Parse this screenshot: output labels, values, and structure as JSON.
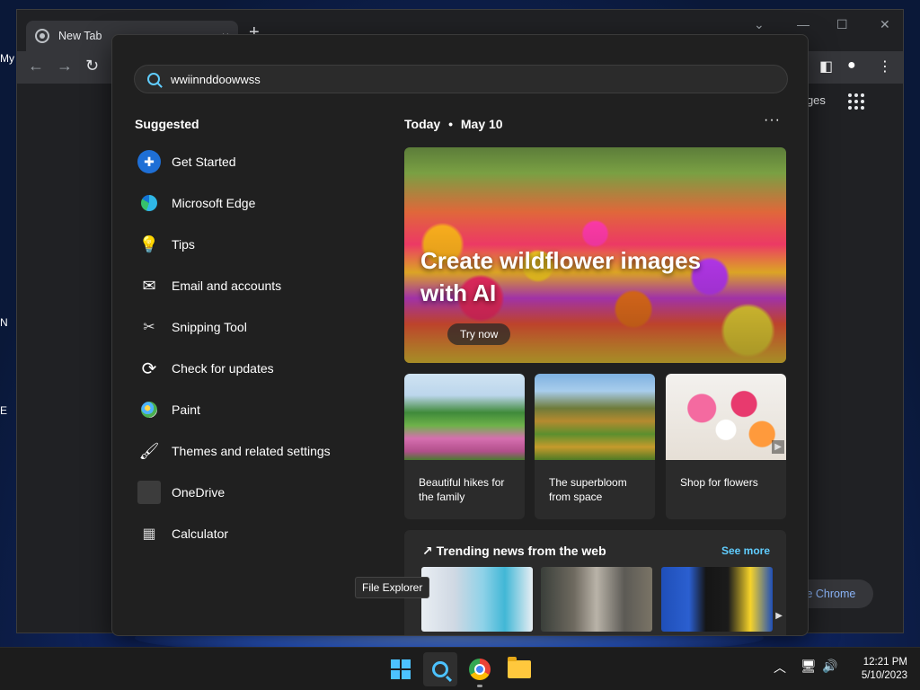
{
  "desktop": {
    "icon_labels": [
      "My",
      "N",
      "E"
    ]
  },
  "chrome": {
    "tab_title": "New Tab",
    "tab_close": "×",
    "new_tab": "+",
    "images_link": "images",
    "customize_label": "mize Chrome"
  },
  "search": {
    "query": "wwiinnddoowwss"
  },
  "suggested": {
    "heading": "Suggested",
    "items": [
      {
        "label": "Get Started",
        "icon": "get-started-icon"
      },
      {
        "label": "Microsoft Edge",
        "icon": "edge-icon"
      },
      {
        "label": "Tips",
        "icon": "tips-icon"
      },
      {
        "label": "Email and accounts",
        "icon": "mail-icon"
      },
      {
        "label": "Snipping Tool",
        "icon": "snipping-tool-icon"
      },
      {
        "label": "Check for updates",
        "icon": "refresh-icon"
      },
      {
        "label": "Paint",
        "icon": "paint-icon"
      },
      {
        "label": "Themes and related settings",
        "icon": "brush-icon"
      },
      {
        "label": "OneDrive",
        "icon": "onedrive-icon"
      },
      {
        "label": "Calculator",
        "icon": "calculator-icon"
      }
    ]
  },
  "today": {
    "heading": "Today",
    "separator": "•",
    "date": "May 10",
    "more": "···",
    "hero": {
      "title": "Create wildflower images with AI",
      "button": "Try now"
    },
    "cards": [
      {
        "text": "Beautiful hikes for the family"
      },
      {
        "text": "The superbloom from space"
      },
      {
        "text": "Shop for flowers"
      }
    ],
    "trending": {
      "heading": "Trending news from the web",
      "see_more": "See more"
    },
    "tooltip": "File Explorer"
  },
  "taskbar": {
    "time": "12:21 PM",
    "date": "5/10/2023"
  },
  "colors": {
    "accent": "#60cdff",
    "flyout_bg": "#202020",
    "card_bg": "#2b2b2b"
  }
}
